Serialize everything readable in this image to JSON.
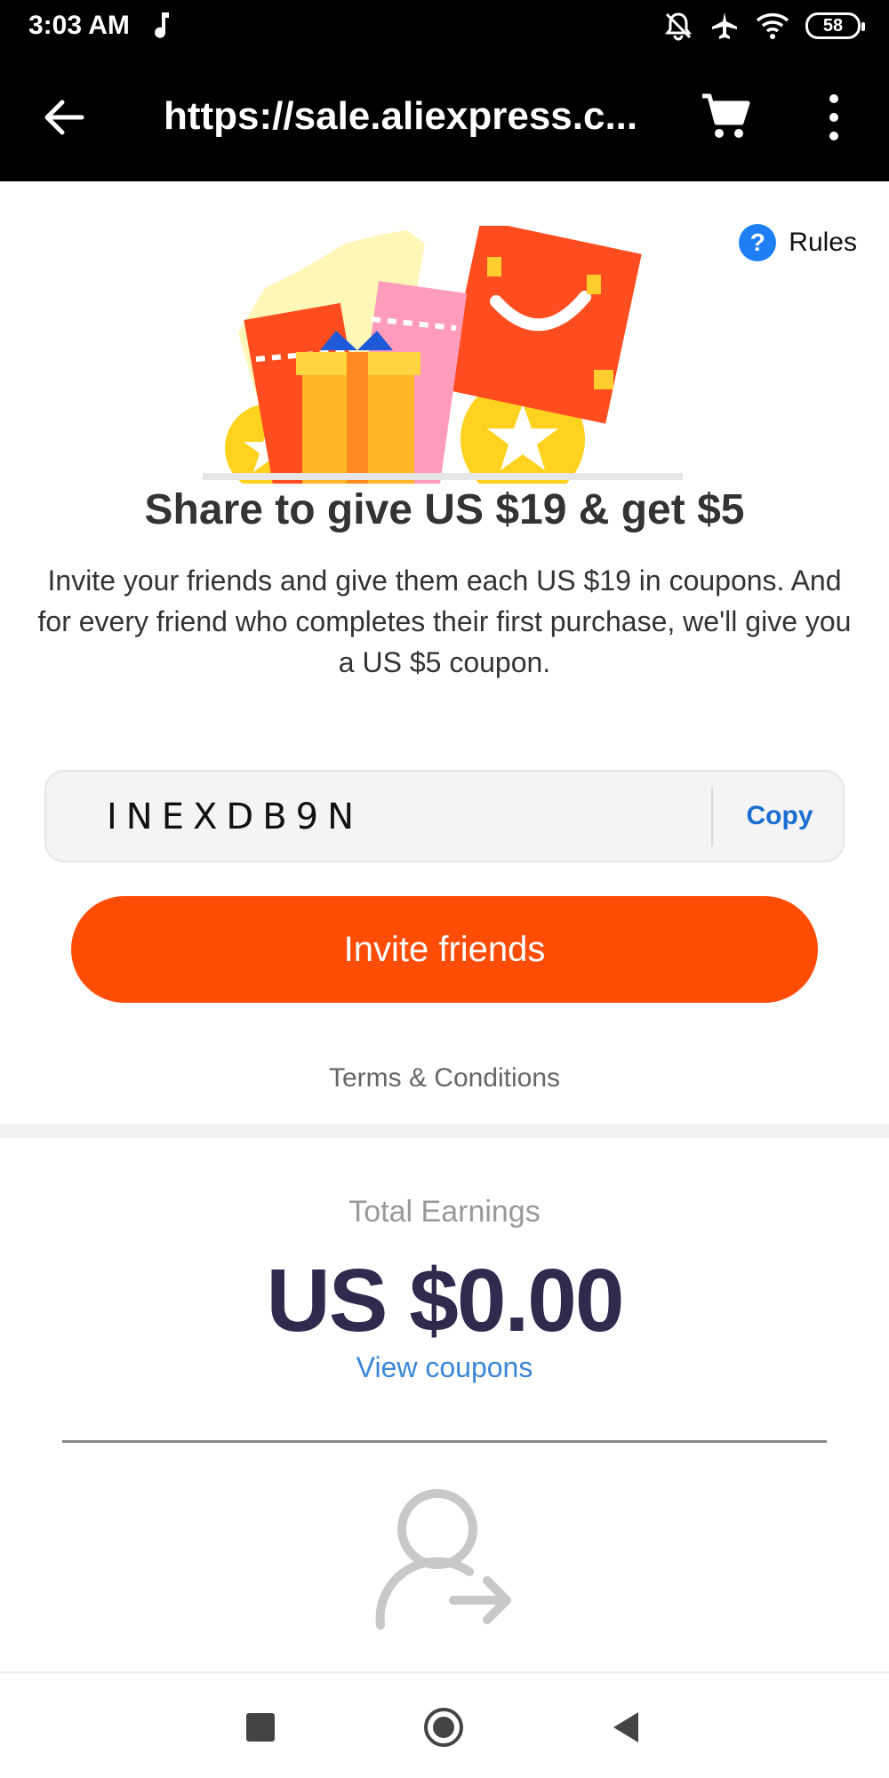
{
  "status_bar": {
    "time": "3:03 AM",
    "battery": "58",
    "icons": [
      "music-note-icon",
      "silent-icon",
      "airplane-icon",
      "wifi-icon",
      "battery-icon"
    ]
  },
  "browser": {
    "url": "https://sale.aliexpress.c...",
    "icons": [
      "back-arrow-icon",
      "cart-icon",
      "more-vertical-icon"
    ]
  },
  "rules": {
    "icon_glyph": "?",
    "label": "Rules"
  },
  "promo": {
    "headline": "Share to give US $19 & get $5",
    "description": "Invite your friends and give them each US $19 in coupons. And for every friend who completes their first purchase, we'll give you a US $5 coupon."
  },
  "invite_code": {
    "code": "INEXDB9N",
    "copy_label": "Copy"
  },
  "invite_button": {
    "label": "Invite friends"
  },
  "terms_label": "Terms & Conditions",
  "earnings": {
    "label": "Total Earnings",
    "value": "US $0.00",
    "view_coupons_label": "View coupons"
  },
  "colors": {
    "accent": "#ff4c07",
    "link": "#3b86d8",
    "earnings_text": "#2e2b4f",
    "rules_icon": "#1e7ff5"
  },
  "nav_bar": {
    "icons": [
      "recent-apps-icon",
      "home-icon",
      "back-icon"
    ]
  }
}
